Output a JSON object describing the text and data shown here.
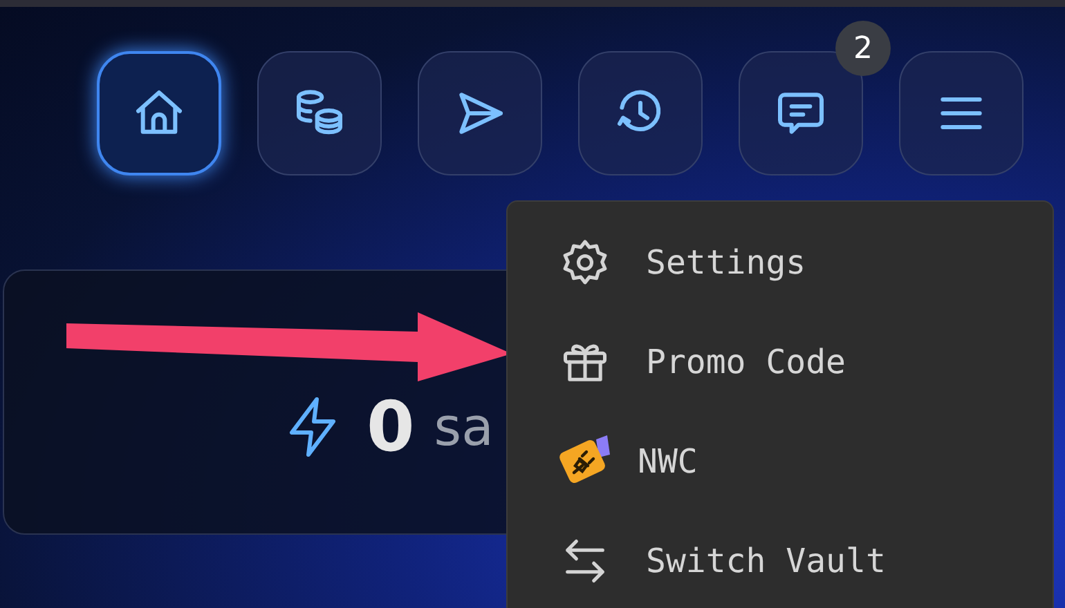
{
  "nav_buttons": [
    {
      "selected": true
    },
    {
      "selected": false
    },
    {
      "selected": false
    },
    {
      "selected": false
    },
    {
      "selected": false,
      "badge": "2"
    },
    {
      "selected": false
    }
  ],
  "balance": {
    "amount": "0",
    "unit": "sa"
  },
  "menu": {
    "items": [
      {
        "label": "Settings"
      },
      {
        "label": "Promo Code"
      },
      {
        "label": "NWC"
      },
      {
        "label": "Switch Vault"
      }
    ]
  }
}
